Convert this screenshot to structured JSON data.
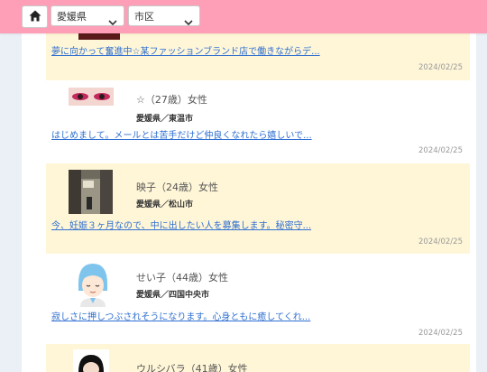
{
  "colors": {
    "topbar": "#ff9eb7",
    "card_yellow": "#fff6d8",
    "link": "#2f6fd1",
    "sideband": "#eaf0f6"
  },
  "header": {
    "home_icon": "home-icon",
    "prefecture_select": "愛媛県",
    "city_select": "市区"
  },
  "posts": [
    {
      "message": "夢に向かって奮進中☆某ファッションブランド店で働きながらデ...",
      "date": "2024/02/25"
    },
    {
      "name": "☆（27歳）女性",
      "location": "愛媛県／東温市",
      "message": "はじめまして。メールとは苦手だけど仲良くなれたら嬉しいで...",
      "date": "2024/02/25"
    },
    {
      "name": "映子（24歳）女性",
      "location": "愛媛県／松山市",
      "message": "今、妊娠３ヶ月なので、中に出したい人を募集します。秘密守...",
      "date": "2024/02/25"
    },
    {
      "name": "せい子（44歳）女性",
      "location": "愛媛県／四国中央市",
      "message": "寂しさに押しつぶされそうになります。心身ともに癒してくれ...",
      "date": "2024/02/25"
    },
    {
      "name": "ウルシバラ（41歳）女性"
    }
  ]
}
